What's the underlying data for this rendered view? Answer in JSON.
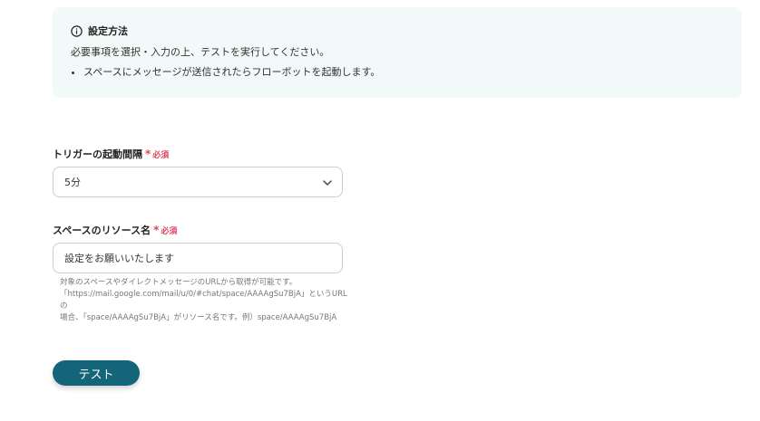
{
  "info": {
    "title": "設定方法",
    "description": "必要事項を選択・入力の上、テストを実行してください。",
    "bullets": [
      "スペースにメッセージが送信されたらフローボットを起動します。"
    ]
  },
  "trigger_interval": {
    "label": "トリガーの起動間隔",
    "required_star": "*",
    "required_text": "必須",
    "value": "5分"
  },
  "space_resource": {
    "label": "スペースのリソース名",
    "required_star": "*",
    "required_text": "必須",
    "value": "設定をお願いいたします",
    "help": "対象のスペースやダイレクトメッセージのURLから取得が可能です。\n「https://mail.google.com/mail/u/0/#chat/space/AAAAgSu7BjA」というURLの\n場合、「space/AAAAgSu7BjA」がリソース名です。例）space/AAAAgSu7BjA"
  },
  "actions": {
    "test_label": "テスト"
  },
  "colors": {
    "accent": "#14657a",
    "required": "#e0455c",
    "info_bg": "#f1faf9"
  }
}
